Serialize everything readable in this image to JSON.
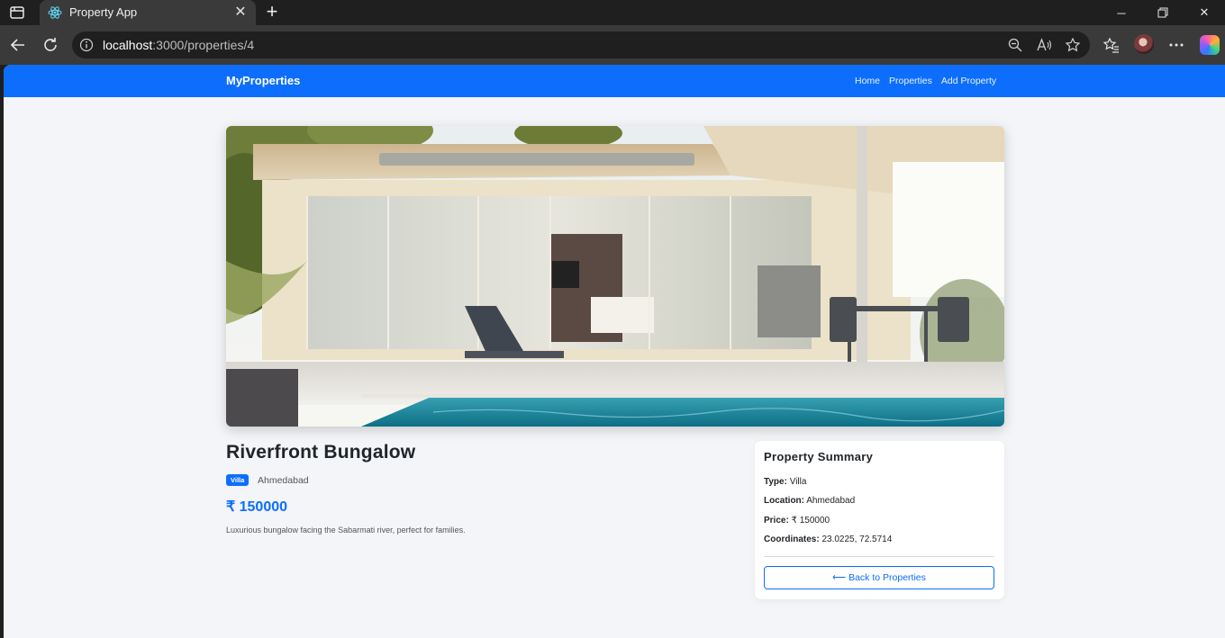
{
  "browser": {
    "tab_title": "Property App",
    "url_host": "localhost",
    "url_rest": ":3000/properties/4"
  },
  "navbar": {
    "brand": "MyProperties",
    "links": [
      "Home",
      "Properties",
      "Add Property"
    ]
  },
  "property": {
    "title": "Riverfront Bungalow",
    "type_badge": "Villa",
    "city": "Ahmedabad",
    "price": "₹ 150000",
    "description": "Luxurious bungalow facing the Sabarmati river, perfect for families."
  },
  "summary": {
    "title": "Property Summary",
    "type_label": "Type:",
    "type_value": "Villa",
    "location_label": "Location:",
    "location_value": "Ahmedabad",
    "price_label": "Price:",
    "price_value": "₹ 150000",
    "coords_label": "Coordinates:",
    "coords_value": "23.0225, 72.5714",
    "back_button": "⟵ Back to Properties"
  },
  "colors": {
    "primary": "#0d6efd",
    "page_bg": "#f3f5f8"
  }
}
